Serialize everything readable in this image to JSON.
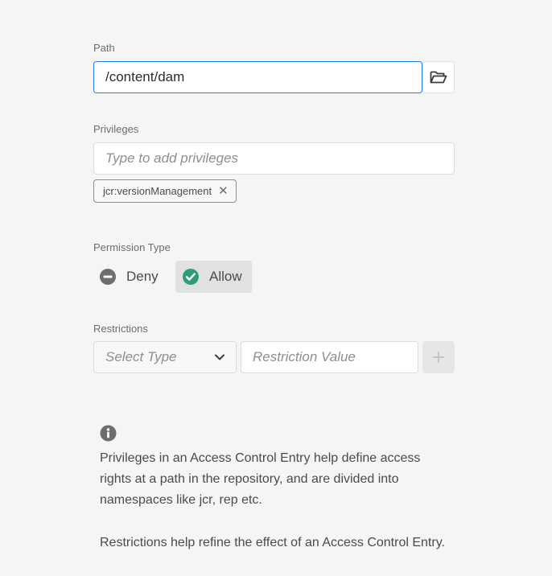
{
  "path": {
    "label": "Path",
    "value": "/content/dam",
    "browse_icon": "folder-open-icon"
  },
  "privileges": {
    "label": "Privileges",
    "placeholder": "Type to add privileges",
    "tags": [
      {
        "label": "jcr:versionManagement",
        "remove_icon": "close-icon"
      }
    ]
  },
  "permission_type": {
    "label": "Permission Type",
    "options": [
      {
        "label": "Deny",
        "icon": "minus-circle-icon",
        "selected": false
      },
      {
        "label": "Allow",
        "icon": "check-circle-icon",
        "selected": true
      }
    ]
  },
  "restrictions": {
    "label": "Restrictions",
    "type_placeholder": "Select Type",
    "value_placeholder": "Restriction Value",
    "add_icon": "plus-icon"
  },
  "info": {
    "icon": "info-icon",
    "paragraph1": "Privileges in an Access Control Entry help define access rights at a path in the repository, and are divided into namespaces like jcr, rep etc.",
    "paragraph2": "Restrictions help refine the effect of an Access Control Entry."
  },
  "colors": {
    "focus": "#2680eb",
    "allow_check": "#2d9d78",
    "deny_icon": "#6e6e6e"
  }
}
